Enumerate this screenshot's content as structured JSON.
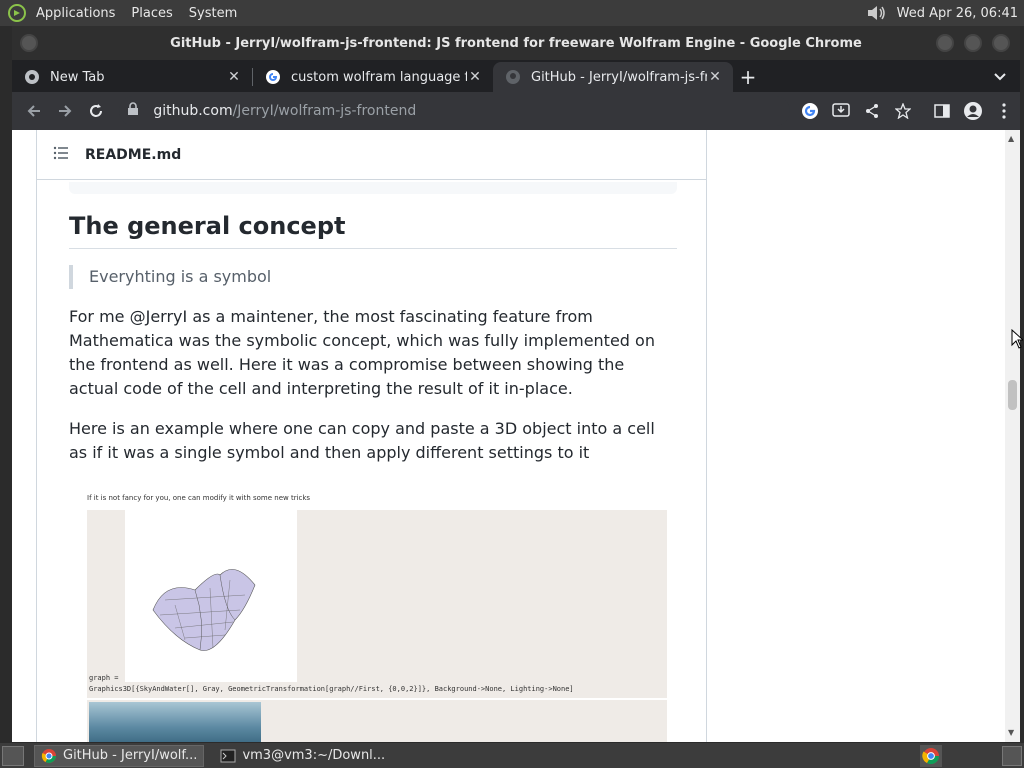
{
  "top_panel": {
    "menus": [
      "Applications",
      "Places",
      "System"
    ],
    "clock": "Wed Apr 26, 06:41"
  },
  "window": {
    "title": "GitHub - JerryI/wolfram-js-frontend: JS frontend for freeware Wolfram Engine - Google Chrome"
  },
  "tabs": [
    {
      "label": "New Tab",
      "icon": "chrome-icon"
    },
    {
      "label": "custom wolfram language fro",
      "icon": "google-icon"
    },
    {
      "label": "GitHub - JerryI/wolfram-js-fro",
      "icon": "github-icon"
    }
  ],
  "omnibox": {
    "host": "github.com",
    "path": "/JerryI/wolfram-js-frontend"
  },
  "readme": {
    "filename": "README.md",
    "heading": "The general concept",
    "quote": "Everyhting is a symbol",
    "paragraph1": "For me @JerryI as a maintener, the most fascinating feature from Mathematica was the symbolic concept, which was fully implemented on the frontend as well. Here it was a compromise between showing the actual code of the cell and interpreting the result of it in-place.",
    "paragraph2": "Here is an example where one can copy and paste a 3D object into a cell as if it was a single symbol and then apply different settings to it",
    "image": {
      "caption": "If it is not fancy for you, one can modify it with some new tricks",
      "code_line1": "graph =",
      "code_line2": "Graphics3D[{SkyAndWater[], Gray, GeometricTransformation[graph//First, {0,0,2}]}, Background->None, Lighting->None]"
    }
  },
  "taskbar": {
    "items": [
      {
        "label": "GitHub - JerryI/wolf...",
        "icon": "chrome-icon"
      },
      {
        "label": "vm3@vm3:~/Downl...",
        "icon": "terminal-icon"
      }
    ]
  }
}
